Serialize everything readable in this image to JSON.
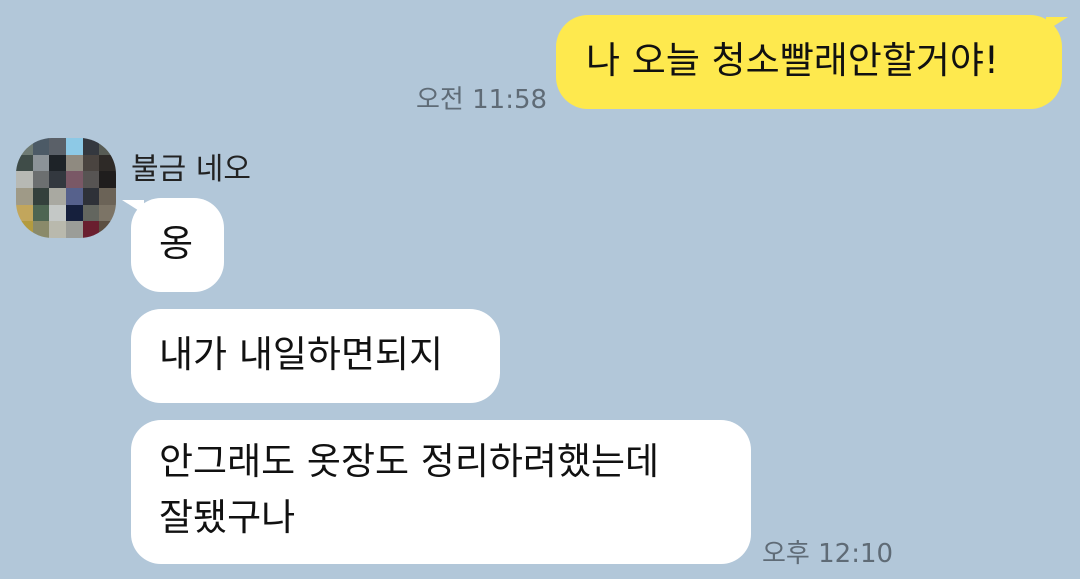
{
  "chat": {
    "my_message": {
      "text": "나 오늘 청소빨래안할거야!",
      "time": "오전 11:58"
    },
    "sender": {
      "name": "불금 네오"
    },
    "their_messages": [
      {
        "text": "옹"
      },
      {
        "text": "내가 내일하면되지"
      },
      {
        "line1": "안그래도 옷장도 정리하려했는데",
        "line2": "잘됐구나"
      }
    ],
    "their_time": "오후 12:10"
  },
  "colors": {
    "background": "#b2c7d9",
    "my_bubble": "#fee94e",
    "their_bubble": "#ffffff",
    "timestamp": "#5f6b76"
  },
  "icons": {
    "avatar": "pixelated-profile-avatar"
  }
}
